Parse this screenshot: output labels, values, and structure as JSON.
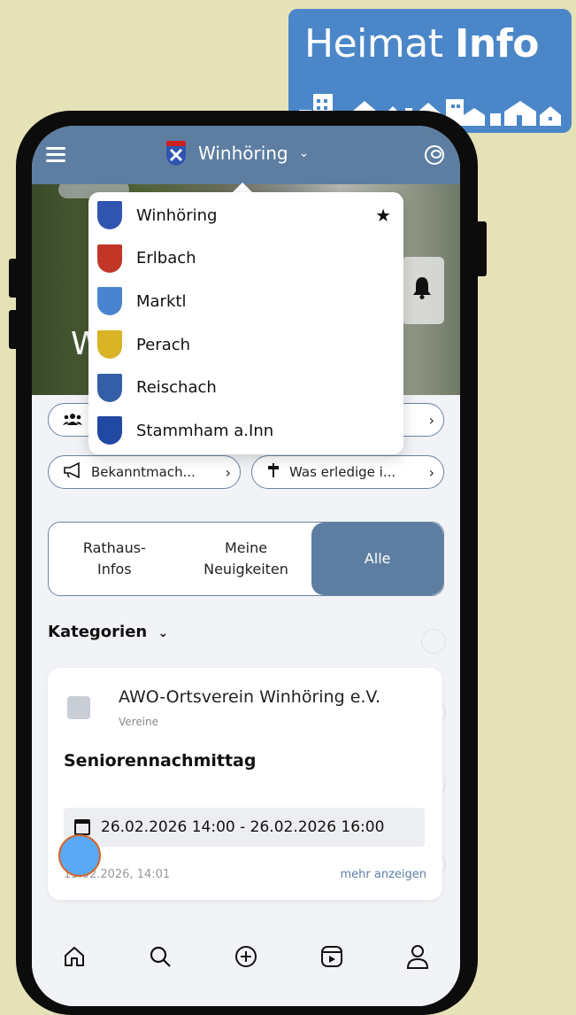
{
  "logo": {
    "text_regular": "Heimat",
    "text_bold": "Info",
    "bg_color": "#4b87c8"
  },
  "header": {
    "community": "Winhöring",
    "chevron": "⌄"
  },
  "hero": {
    "partial_text": "W"
  },
  "dropdown": {
    "items": [
      {
        "label": "Winhöring",
        "favorite": true,
        "crest_color": "#2f55b0"
      },
      {
        "label": "Erlbach",
        "favorite": false,
        "crest_color": "#c23628"
      },
      {
        "label": "Marktl",
        "favorite": false,
        "crest_color": "#4a84d1"
      },
      {
        "label": "Perach",
        "favorite": false,
        "crest_color": "#d8b426"
      },
      {
        "label": "Reischach",
        "favorite": false,
        "crest_color": "#345fa6"
      },
      {
        "label": "Stammham a.Inn",
        "favorite": false,
        "crest_color": "#2249a2"
      }
    ],
    "star": "★"
  },
  "chips": {
    "row1_arrow": "›",
    "bekanntmachungen": "Bekanntmach...",
    "was_erledige": "Was erledige i...",
    "arrow": "›"
  },
  "segments": [
    {
      "label": "Rathaus-\nInfos",
      "active": false
    },
    {
      "label": "Meine\nNeuigkeiten",
      "active": false
    },
    {
      "label": "Alle",
      "active": true
    }
  ],
  "kategorien": {
    "label": "Kategorien",
    "chevron": "⌄"
  },
  "card": {
    "organization": "AWO-Ortsverein Winhöring e.V.",
    "category": "Vereine",
    "title": "Seniorennachmittag",
    "dates": "26.02.2026 14:00 - 26.02.2026 16:00",
    "posted": "13.02.2026, 14:01",
    "more": "mehr anzeigen"
  },
  "colors": {
    "primary": "#5d7ea1",
    "background": "#e6e2b8",
    "fab": "#5aa9f6"
  },
  "bottom_nav": [
    "home-icon",
    "search-icon",
    "add-icon",
    "video-icon",
    "profile-icon"
  ]
}
